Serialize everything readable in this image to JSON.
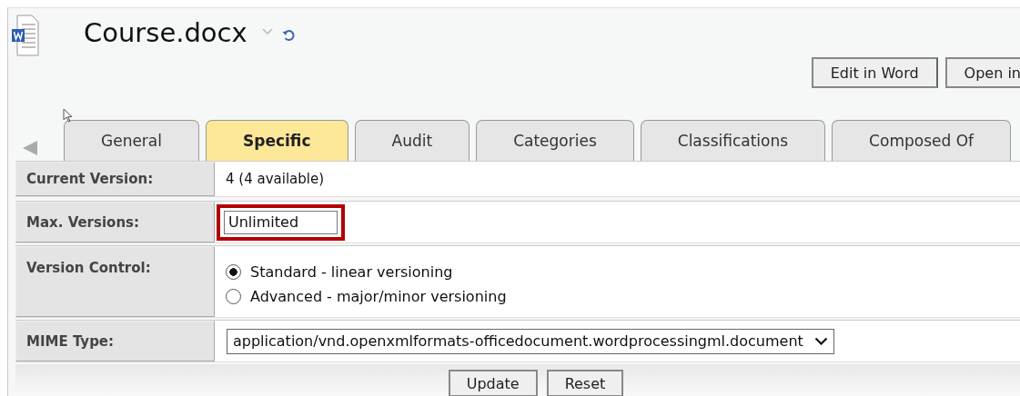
{
  "document": {
    "title": "Course.docx"
  },
  "toolbar": {
    "buttons": [
      "Edit in Word",
      "Open in"
    ]
  },
  "tabs": [
    {
      "label": "General",
      "selected": false
    },
    {
      "label": "Specific",
      "selected": true
    },
    {
      "label": "Audit",
      "selected": false
    },
    {
      "label": "Categories",
      "selected": false
    },
    {
      "label": "Classifications",
      "selected": false
    },
    {
      "label": "Composed Of",
      "selected": false
    }
  ],
  "form": {
    "rows": [
      {
        "kind": "text",
        "label": "Current Version:",
        "value": "4 (4 available)"
      },
      {
        "kind": "input",
        "label": "Max. Versions:",
        "value": "Unlimited",
        "highlighted": true
      },
      {
        "kind": "radio",
        "label": "Version Control:",
        "options": [
          {
            "label": "Standard - linear versioning",
            "selected": true
          },
          {
            "label": "Advanced - major/minor versioning",
            "selected": false
          }
        ]
      },
      {
        "kind": "select",
        "label": "MIME Type:",
        "value": "application/vnd.openxmlformats-officedocument.wordprocessingml.document"
      }
    ]
  },
  "footer": {
    "buttons": [
      "Update",
      "Reset"
    ]
  }
}
